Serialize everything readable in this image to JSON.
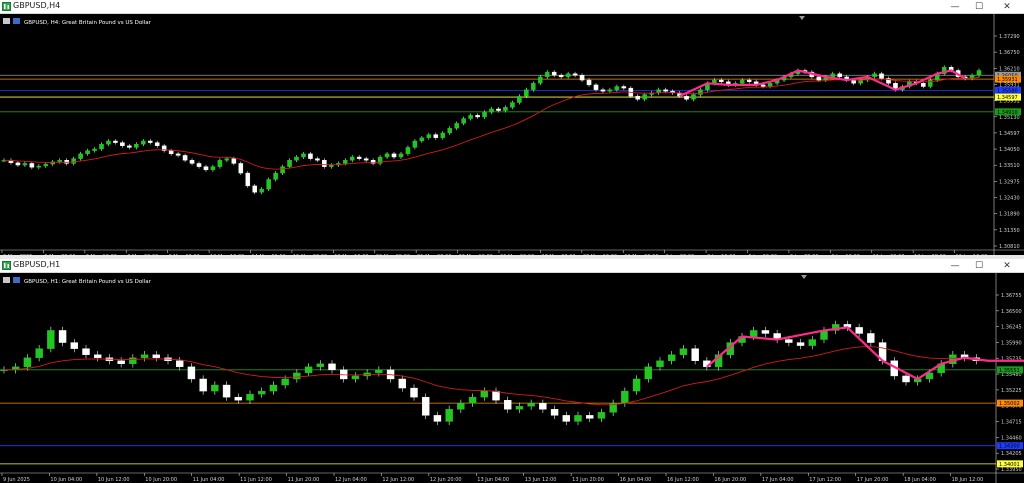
{
  "top": {
    "title": "GBPUSD,H4",
    "label": "GBPUSD, H4:  Great Britain Pound vs US Dollar",
    "prices": [
      "1.37290",
      "1.36750",
      "1.36210",
      "1.35931",
      "1.35931",
      "1.35130",
      "1.34597",
      "1.34050",
      "1.33510",
      "1.32975",
      "1.32430",
      "1.31890",
      "1.31350",
      "1.30810"
    ],
    "time_labels": [
      "2 May 2025",
      "5 May 08:00",
      "6 May 16:00",
      "8 May 00:00",
      "9 May 08:00",
      "12 May 16:00",
      "14 May 00:00",
      "15 May 08:00",
      "16 May 16:00",
      "20 May 00:00",
      "21 May 08:00",
      "22 May 16:00",
      "26 May 00:00",
      "27 May 08:00",
      "28 May 16:00",
      "30 May 00:00",
      "2 Jun 08:00",
      "3 Jun 16:00",
      "5 Jun 00:00",
      "6 Jun 08:00",
      "9 Jun 16:00",
      "11 Jun 00:00",
      "12 Jun 08:00",
      "13 Jun 16:00"
    ],
    "candles": [
      1.334,
      1.3332,
      1.3325,
      1.333,
      1.3318,
      1.3322,
      1.3328,
      1.3335,
      1.334,
      1.333,
      1.3345,
      1.336,
      1.337,
      1.3375,
      1.339,
      1.34,
      1.3395,
      1.3385,
      1.338,
      1.339,
      1.34,
      1.3395,
      1.3385,
      1.337,
      1.336,
      1.3355,
      1.334,
      1.333,
      1.332,
      1.331,
      1.332,
      1.334,
      1.3345,
      1.333,
      1.33,
      1.326,
      1.324,
      1.325,
      1.328,
      1.33,
      1.332,
      1.334,
      1.335,
      1.336,
      1.3345,
      1.334,
      1.332,
      1.3325,
      1.333,
      1.334,
      1.335,
      1.3345,
      1.334,
      1.333,
      1.335,
      1.336,
      1.335,
      1.336,
      1.338,
      1.34,
      1.341,
      1.342,
      1.341,
      1.3425,
      1.344,
      1.3455,
      1.347,
      1.348,
      1.3475,
      1.349,
      1.35,
      1.3495,
      1.3505,
      1.352,
      1.354,
      1.356,
      1.358,
      1.36,
      1.3615,
      1.3605,
      1.36,
      1.361,
      1.3605,
      1.359,
      1.3575,
      1.356,
      1.3555,
      1.356,
      1.357,
      1.3565,
      1.354,
      1.353,
      1.3545,
      1.355,
      1.356,
      1.3555,
      1.355,
      1.354,
      1.353,
      1.3545,
      1.356,
      1.358,
      1.359,
      1.3585,
      1.3575,
      1.358,
      1.359,
      1.3585,
      1.3575,
      1.357,
      1.358,
      1.359,
      1.36,
      1.361,
      1.362,
      1.3615,
      1.36,
      1.359,
      1.36,
      1.361,
      1.36,
      1.359,
      1.358,
      1.359,
      1.36,
      1.361,
      1.3595,
      1.358,
      1.356,
      1.357,
      1.3585,
      1.358,
      1.357,
      1.359,
      1.361,
      1.363,
      1.362,
      1.36,
      1.3595,
      1.3605,
      1.362
    ],
    "hlines": [
      {
        "price": 1.3605,
        "color": "#9a9a9a"
      },
      {
        "price": 1.35931,
        "color": "#ff8c00"
      },
      {
        "price": 1.3558,
        "color": "#1e3cff"
      },
      {
        "price": 1.3537,
        "color": "#ffff40"
      },
      {
        "price": 1.3491,
        "color": "#1c9a1c"
      }
    ],
    "tags": [
      {
        "text": "1.36050",
        "color": "#9a9a9a"
      },
      {
        "text": "1.35931",
        "color": "#ff8c00"
      },
      {
        "text": "1.35580",
        "color": "#1e3cff"
      },
      {
        "text": "1.34597",
        "color": "#ffff40"
      },
      {
        "text": "1.34910",
        "color": "#1c9a1c"
      }
    ]
  },
  "bottom": {
    "title": "GBPUSD,H1",
    "label": "GBPUSD, H1:  Great Britain Pound vs US Dollar",
    "prices": [
      "1.36755",
      "1.36500",
      "1.36245",
      "1.35990",
      "1.35735",
      "1.35480",
      "1.35225",
      "1.34970",
      "1.34715",
      "1.34460",
      "1.34205",
      "1.33950"
    ],
    "tags": [
      {
        "text": "1.35551",
        "color": "#1c9a1c"
      },
      {
        "text": "1.35002",
        "color": "#ff8c00"
      },
      {
        "text": "1.34300",
        "color": "#1e3cff"
      },
      {
        "text": "1.34001",
        "color": "#ffff40"
      }
    ],
    "hlines": [
      {
        "price": 1.35551,
        "color": "#1c9a1c"
      },
      {
        "price": 1.35002,
        "color": "#ff8c00"
      },
      {
        "price": 1.343,
        "color": "#1e3cff"
      },
      {
        "price": 1.34001,
        "color": "#ffff40"
      }
    ],
    "candles": [
      1.3555,
      1.356,
      1.3575,
      1.359,
      1.362,
      1.36,
      1.359,
      1.358,
      1.3575,
      1.357,
      1.3565,
      1.3575,
      1.358,
      1.3575,
      1.357,
      1.356,
      1.354,
      1.352,
      1.353,
      1.351,
      1.3505,
      1.3515,
      1.352,
      1.353,
      1.354,
      1.355,
      1.356,
      1.3565,
      1.3555,
      1.354,
      1.3545,
      1.355,
      1.3555,
      1.354,
      1.3525,
      1.351,
      1.348,
      1.347,
      1.349,
      1.35,
      1.351,
      1.352,
      1.3505,
      1.349,
      1.3495,
      1.35,
      1.349,
      1.348,
      1.347,
      1.348,
      1.3475,
      1.3485,
      1.35,
      1.352,
      1.354,
      1.356,
      1.357,
      1.358,
      1.359,
      1.357,
      1.356,
      1.358,
      1.36,
      1.361,
      1.362,
      1.3615,
      1.3605,
      1.36,
      1.3595,
      1.3605,
      1.362,
      1.363,
      1.3625,
      1.3615,
      1.36,
      1.357,
      1.3545,
      1.3535,
      1.354,
      1.355,
      1.3565,
      1.358,
      1.3575,
      1.357
    ],
    "time_labels": [
      "9 Jun 2025",
      "10 Jun 04:00",
      "10 Jun 12:00",
      "10 Jun 20:00",
      "11 Jun 04:00",
      "11 Jun 12:00",
      "11 Jun 20:00",
      "12 Jun 04:00",
      "12 Jun 12:00",
      "12 Jun 20:00",
      "13 Jun 04:00",
      "13 Jun 12:00",
      "13 Jun 20:00",
      "16 Jun 04:00",
      "16 Jun 12:00",
      "16 Jun 20:00",
      "17 Jun 04:00",
      "17 Jun 12:00",
      "17 Jun 20:00",
      "18 Jun 04:00",
      "18 Jun 12:00"
    ]
  },
  "window_buttons": {
    "min": "—",
    "max": "☐",
    "close": "✕"
  }
}
